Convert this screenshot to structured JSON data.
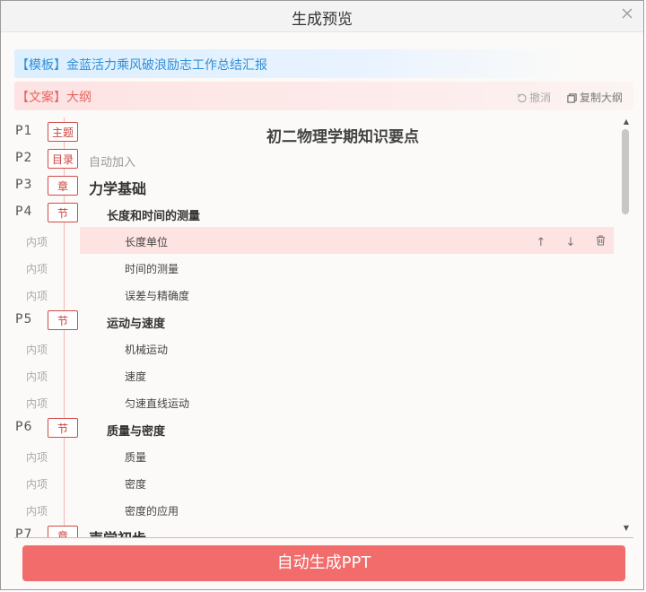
{
  "dialog": {
    "title": "生成预览",
    "close_icon": "close-icon"
  },
  "template_banner": {
    "text": "【模板】金蓝活力乘风破浪励志工作总结汇报",
    "color": "#2f8fd8"
  },
  "copy_banner": {
    "label": "【文案】大纲",
    "undo_label": "撤消",
    "copy_label": "复制大纲",
    "color": "#e8645f"
  },
  "outline": {
    "rows": [
      {
        "type": "topic",
        "page": "P1",
        "tag": "主题",
        "text": "初二物理学期知识要点"
      },
      {
        "type": "toc",
        "page": "P2",
        "tag": "目录",
        "text": "自动加入"
      },
      {
        "type": "chapter",
        "page": "P3",
        "tag": "章",
        "text": "力学基础"
      },
      {
        "type": "section",
        "page": "P4",
        "tag": "节",
        "text": "长度和时间的测量"
      },
      {
        "type": "item",
        "inner": "内项",
        "text": "长度单位",
        "active": true
      },
      {
        "type": "item",
        "inner": "内项",
        "text": "时间的测量"
      },
      {
        "type": "item",
        "inner": "内项",
        "text": "误差与精确度"
      },
      {
        "type": "section",
        "page": "P5",
        "tag": "节",
        "text": "运动与速度"
      },
      {
        "type": "item",
        "inner": "内项",
        "text": "机械运动"
      },
      {
        "type": "item",
        "inner": "内项",
        "text": "速度"
      },
      {
        "type": "item",
        "inner": "内项",
        "text": "匀速直线运动"
      },
      {
        "type": "section",
        "page": "P6",
        "tag": "节",
        "text": "质量与密度"
      },
      {
        "type": "item",
        "inner": "内项",
        "text": "质量"
      },
      {
        "type": "item",
        "inner": "内项",
        "text": "密度"
      },
      {
        "type": "item",
        "inner": "内项",
        "text": "密度的应用"
      },
      {
        "type": "chapter",
        "page": "P7",
        "tag": "章",
        "text": "声学初步"
      }
    ],
    "row_actions": {
      "up": "↑",
      "down": "↓"
    }
  },
  "generate_button": {
    "label": "自动生成PPT",
    "color": "#f26c6c"
  }
}
